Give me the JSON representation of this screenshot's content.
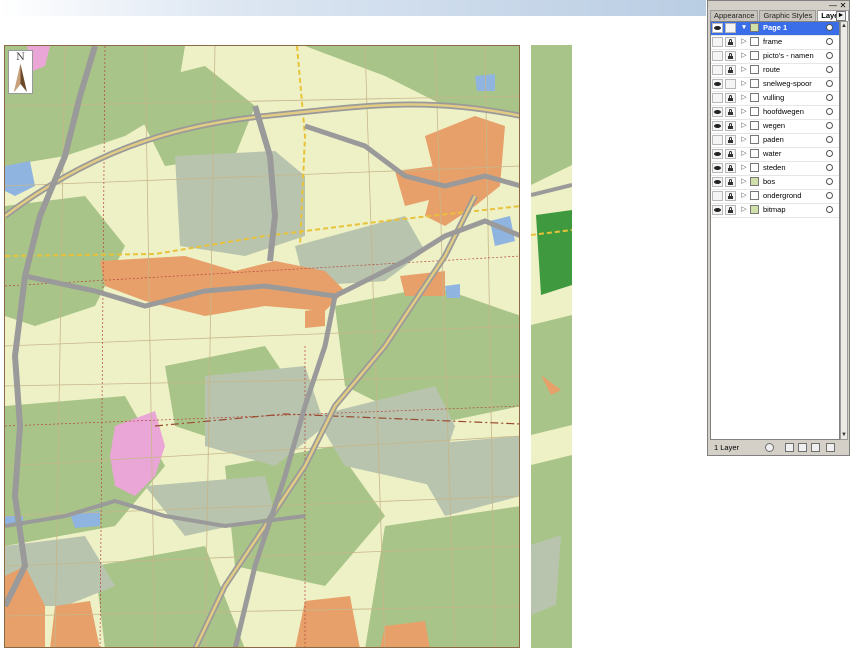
{
  "panel": {
    "tabs": [
      {
        "label": "Appearance",
        "active": false
      },
      {
        "label": "Graphic Styles",
        "active": false
      },
      {
        "label": "Layers",
        "active": true
      }
    ],
    "layers": [
      {
        "name": "Page 1",
        "visible": true,
        "locked": false,
        "selected": true,
        "expanded": true
      },
      {
        "name": "frame",
        "visible": false,
        "locked": true,
        "selected": false
      },
      {
        "name": "picto's - namen",
        "visible": false,
        "locked": true,
        "selected": false
      },
      {
        "name": "route",
        "visible": false,
        "locked": true,
        "selected": false
      },
      {
        "name": "snelweg-spoor",
        "visible": true,
        "locked": false,
        "selected": false
      },
      {
        "name": "vulling",
        "visible": false,
        "locked": true,
        "selected": false
      },
      {
        "name": "hoofdwegen",
        "visible": true,
        "locked": true,
        "selected": false
      },
      {
        "name": "wegen",
        "visible": true,
        "locked": true,
        "selected": false
      },
      {
        "name": "paden",
        "visible": false,
        "locked": true,
        "selected": false
      },
      {
        "name": "water",
        "visible": true,
        "locked": true,
        "selected": false
      },
      {
        "name": "steden",
        "visible": true,
        "locked": true,
        "selected": false
      },
      {
        "name": "bos",
        "visible": true,
        "locked": true,
        "selected": false
      },
      {
        "name": "ondergrond",
        "visible": false,
        "locked": true,
        "selected": false
      },
      {
        "name": "bitmap",
        "visible": true,
        "locked": true,
        "selected": false
      }
    ],
    "footer_count": "1 Layer"
  },
  "map": {
    "compass_letter": "N"
  },
  "colors": {
    "selection": "#3a6ee8",
    "urban": "#e8a06a",
    "forest": "#a9c488",
    "grass": "#eef1c6",
    "forest_dark": "#b8c4ae",
    "highway": "#9a9a9a",
    "highway_core": "#e2cc84",
    "water": "#8fb4df",
    "recreation": "#eaa6d6"
  }
}
